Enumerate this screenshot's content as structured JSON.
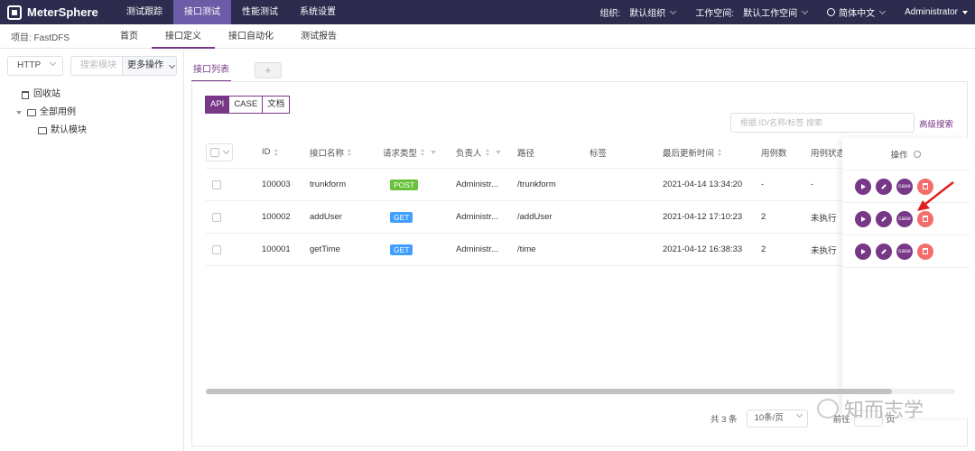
{
  "app": {
    "name": "MeterSphere"
  },
  "topnav": {
    "items": [
      "测试跟踪",
      "接口测试",
      "性能测试",
      "系统设置"
    ],
    "active_index": 1
  },
  "topright": {
    "org_label": "组织:",
    "org_value": "默认组织",
    "workspace_label": "工作空间:",
    "workspace_value": "默认工作空间",
    "language": "简体中文",
    "user": "Administrator"
  },
  "subnav": {
    "project": "项目: FastDFS",
    "tabs": [
      "首页",
      "接口定义",
      "接口自动化",
      "测试报告"
    ],
    "active_index": 1
  },
  "sidebar": {
    "protocol": "HTTP",
    "search_placeholder": "搜索模块",
    "more_ops": "更多操作",
    "tree": {
      "trash": "回收站",
      "all_cases": "全部用例",
      "default_module": "默认模块"
    }
  },
  "main": {
    "tab_label": "接口列表",
    "add_tab": "+",
    "segments": [
      "API",
      "CASE",
      "文档"
    ],
    "active_segment": 0,
    "search_placeholder": "根据 ID/名称/标签 搜索",
    "advanced_search": "高级搜索"
  },
  "table": {
    "columns": {
      "id": "ID",
      "name": "接口名称",
      "method": "请求类型",
      "owner": "负责人",
      "path": "路径",
      "tags": "标签",
      "updated": "最后更新时间",
      "case_count": "用例数",
      "case_status": "用例状态",
      "ops": "操作"
    },
    "rows": [
      {
        "id": "100003",
        "name": "trunkform",
        "method": "POST",
        "owner": "Administr...",
        "path": "/trunkform",
        "updated": "2021-04-14 13:34:20",
        "case_count": "-",
        "case_status": "-"
      },
      {
        "id": "100002",
        "name": "addUser",
        "method": "GET",
        "owner": "Administr...",
        "path": "/addUser",
        "updated": "2021-04-12 17:10:23",
        "case_count": "2",
        "case_status": "未执行"
      },
      {
        "id": "100001",
        "name": "getTime",
        "method": "GET",
        "owner": "Administr...",
        "path": "/time",
        "updated": "2021-04-12 16:38:33",
        "case_count": "2",
        "case_status": "未执行"
      }
    ],
    "op_case_label": "case"
  },
  "pager": {
    "total": "共 3 条",
    "page_size": "10条/页",
    "goto_prefix": "前往",
    "goto_suffix": "页"
  },
  "watermark": "知而志学",
  "colors": {
    "nav_bg": "#2d2b4e",
    "nav_active": "#6c5ba7",
    "accent": "#783887",
    "post": "#67c23a",
    "get": "#409eff",
    "danger": "#f56c6c",
    "arrow": "#e02020"
  }
}
